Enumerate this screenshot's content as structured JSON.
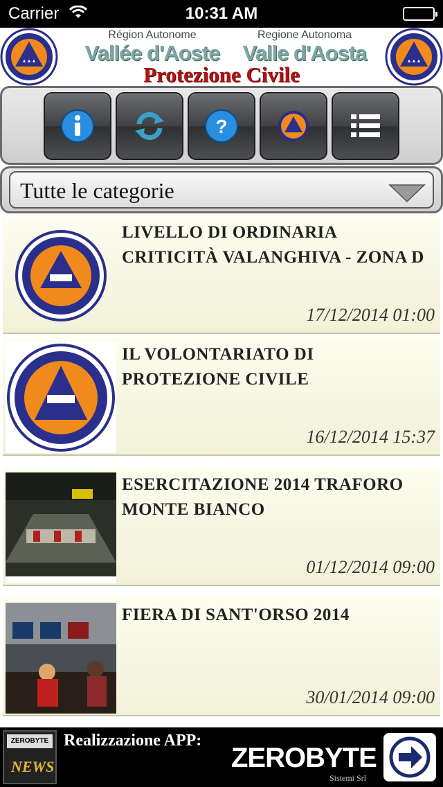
{
  "status_bar": {
    "carrier": "Carrier",
    "time": "10:31 AM",
    "battery_level": 1.0
  },
  "header": {
    "region_fr_small": "Région Autonome",
    "region_fr_big": "Vallée d'Aoste",
    "region_it_small": "Regione Autonoma",
    "region_it_big": "Valle d'Aosta",
    "title": "Protezione Civile",
    "logo_left": "protection-civile-logo",
    "logo_right": "protection-civile-logo"
  },
  "toolbar": {
    "buttons": [
      {
        "name": "info-icon"
      },
      {
        "name": "refresh-icon"
      },
      {
        "name": "help-icon"
      },
      {
        "name": "triangle-logo-icon"
      },
      {
        "name": "list-icon"
      }
    ]
  },
  "category": {
    "selected": "Tutte le categorie"
  },
  "news": [
    {
      "title": "LIVELLO DI ORDINARIA CRITICITÀ VALANGHIVA - ZONA D",
      "date": "17/12/2014 01:00",
      "thumb": "protection-civile-logo"
    },
    {
      "title": "IL VOLONTARIATO DI PROTEZIONE CIVILE",
      "date": "16/12/2014 15:37",
      "thumb": "volontariat-logo"
    },
    {
      "title": "ESERCITAZIONE 2014 TRAFORO MONTE BIANCO",
      "date": "01/12/2014 09:00",
      "thumb": "tunnel-photo"
    },
    {
      "title": "FIERA DI SANT'ORSO 2014",
      "date": "30/01/2014 09:00",
      "thumb": "control-room-photo"
    }
  ],
  "footer": {
    "newsbox_label": "ZEROBYTE",
    "newsbox_news": "NEWS",
    "realizzazione": "Realizzazione APP:",
    "brand": "ZEROBYTE",
    "brand_sub": "Sistemi Srl"
  },
  "colors": {
    "accent_red": "#b01414",
    "logo_orange": "#f08a1c",
    "logo_blue": "#2a2f8c",
    "item_bg": "#f6f5e0"
  }
}
